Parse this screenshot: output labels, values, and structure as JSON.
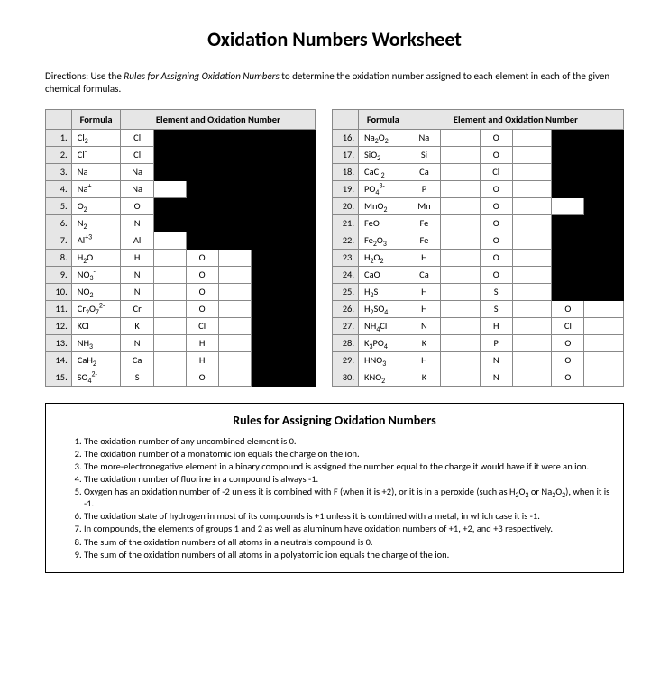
{
  "title": "Oxidation Numbers Worksheet",
  "directions_prefix": "Directions:  Use the ",
  "directions_italic": "Rules for Assigning Oxidation Numbers",
  "directions_suffix": " to determine the oxidation number assigned to each element in each of the given chemical formulas.",
  "left_header_formula": "Formula",
  "left_header_elox": "Element and Oxidation Number",
  "right_header_formula": "Formula",
  "right_header_elox": "Element and Oxidation Number",
  "left_rows": [
    {
      "n": "1.",
      "formula": "Cl<sub>2</sub>",
      "el1": "Cl",
      "el2": "",
      "el3": "",
      "black": [
        2,
        3,
        4,
        5,
        6
      ]
    },
    {
      "n": "2.",
      "formula": "Cl<sup>-</sup>",
      "el1": "Cl",
      "el2": "",
      "el3": "",
      "black": [
        2,
        3,
        4,
        5,
        6
      ]
    },
    {
      "n": "3.",
      "formula": "Na",
      "el1": "Na",
      "el2": "",
      "el3": "",
      "black": [
        2,
        3,
        4,
        5,
        6
      ]
    },
    {
      "n": "4.",
      "formula": "Na<sup>+</sup>",
      "el1": "Na",
      "el2": "",
      "el3": "",
      "black": [
        3,
        4,
        5,
        6
      ]
    },
    {
      "n": "5.",
      "formula": "O<sub>2</sub>",
      "el1": "O",
      "el2": "",
      "el3": "",
      "black": [
        2,
        3,
        4,
        5,
        6
      ]
    },
    {
      "n": "6.",
      "formula": "N<sub>2</sub>",
      "el1": "N",
      "el2": "",
      "el3": "",
      "black": [
        2,
        3,
        4,
        5,
        6
      ]
    },
    {
      "n": "7.",
      "formula": "Al<sup>+3</sup>",
      "el1": "Al",
      "el2": "",
      "el3": "",
      "black": [
        3,
        4,
        5,
        6
      ]
    },
    {
      "n": "8.",
      "formula": "H<sub>2</sub>O",
      "el1": "H",
      "el2": "O",
      "el3": "",
      "black": [
        5,
        6
      ]
    },
    {
      "n": "9.",
      "formula": "NO<sub>3</sub><sup>-</sup>",
      "el1": "N",
      "el2": "O",
      "el3": "",
      "black": [
        5,
        6
      ]
    },
    {
      "n": "10.",
      "formula": "NO<sub>2</sub>",
      "el1": "N",
      "el2": "O",
      "el3": "",
      "black": [
        5,
        6
      ]
    },
    {
      "n": "11.",
      "formula": "Cr<sub>2</sub>O<sub>7</sub><sup>2-</sup>",
      "el1": "Cr",
      "el2": "O",
      "el3": "",
      "black": [
        5,
        6
      ]
    },
    {
      "n": "12.",
      "formula": "KCl",
      "el1": "K",
      "el2": "Cl",
      "el3": "",
      "black": [
        5,
        6
      ]
    },
    {
      "n": "13.",
      "formula": "NH<sub>3</sub>",
      "el1": "N",
      "el2": "H",
      "el3": "",
      "black": [
        5,
        6
      ]
    },
    {
      "n": "14.",
      "formula": "CaH<sub>2</sub>",
      "el1": "Ca",
      "el2": "H",
      "el3": "",
      "black": [
        5,
        6
      ]
    },
    {
      "n": "15.",
      "formula": "SO<sub>4</sub><sup>2-</sup>",
      "el1": "S",
      "el2": "O",
      "el3": "",
      "black": [
        5,
        6
      ]
    }
  ],
  "right_rows": [
    {
      "n": "16.",
      "formula": "Na<sub>2</sub>O<sub>2</sub>",
      "el1": "Na",
      "el2": "O",
      "el3": "",
      "black": [
        5,
        6
      ]
    },
    {
      "n": "17.",
      "formula": "SiO<sub>2</sub>",
      "el1": "Si",
      "el2": "O",
      "el3": "",
      "black": [
        5,
        6
      ]
    },
    {
      "n": "18.",
      "formula": "CaCl<sub>2</sub>",
      "el1": "Ca",
      "el2": "Cl",
      "el3": "",
      "black": [
        5,
        6
      ]
    },
    {
      "n": "19.",
      "formula": "PO<sub>4</sub><sup>3-</sup>",
      "el1": "P",
      "el2": "O",
      "el3": "",
      "black": [
        5,
        6
      ]
    },
    {
      "n": "20.",
      "formula": "MnO<sub>2</sub>",
      "el1": "Mn",
      "el2": "O",
      "el3": "",
      "black": [
        6
      ]
    },
    {
      "n": "21.",
      "formula": "FeO",
      "el1": "Fe",
      "el2": "O",
      "el3": "",
      "black": [
        5,
        6
      ]
    },
    {
      "n": "22.",
      "formula": "Fe<sub>2</sub>O<sub>3</sub>",
      "el1": "Fe",
      "el2": "O",
      "el3": "",
      "black": [
        5,
        6
      ]
    },
    {
      "n": "23.",
      "formula": "H<sub>2</sub>O<sub>2</sub>",
      "el1": "H",
      "el2": "O",
      "el3": "",
      "black": [
        5,
        6
      ]
    },
    {
      "n": "24.",
      "formula": "CaO",
      "el1": "Ca",
      "el2": "O",
      "el3": "",
      "black": [
        5,
        6
      ]
    },
    {
      "n": "25.",
      "formula": "H<sub>2</sub>S",
      "el1": "H",
      "el2": "S",
      "el3": "",
      "black": [
        5,
        6
      ]
    },
    {
      "n": "26.",
      "formula": "H<sub>2</sub>SO<sub>4</sub>",
      "el1": "H",
      "el2": "S",
      "el3": "O",
      "black": []
    },
    {
      "n": "27.",
      "formula": "NH<sub>4</sub>Cl",
      "el1": "N",
      "el2": "H",
      "el3": "Cl",
      "black": []
    },
    {
      "n": "28.",
      "formula": "K<sub>3</sub>PO<sub>4</sub>",
      "el1": "K",
      "el2": "P",
      "el3": "O",
      "black": []
    },
    {
      "n": "29.",
      "formula": "HNO<sub>3</sub>",
      "el1": "H",
      "el2": "N",
      "el3": "O",
      "black": []
    },
    {
      "n": "30.",
      "formula": "KNO<sub>2</sub>",
      "el1": "K",
      "el2": "N",
      "el3": "O",
      "black": []
    }
  ],
  "rules_title": "Rules for Assigning Oxidation Numbers",
  "rules": [
    "The oxidation number of any uncombined element is 0.",
    "The oxidation number of a monatomic ion equals the charge on the ion.",
    "The more-electronegative element in a binary compound is assigned the number equal to the charge it would have if it were an ion.",
    "The oxidation number of fluorine in a compound is always -1.",
    "Oxygen has an oxidation number of -2 unless it is combined with F (when it is +2), or it is in a peroxide (such as H<sub>2</sub>O<sub>2</sub> or Na<sub>2</sub>O<sub>2</sub>), when it is -1.",
    "The oxidation state of hydrogen in most of its compounds is +1 unless it is combined with a metal, in which case it is -1.",
    "In compounds, the elements of groups 1 and 2 as well as aluminum have oxidation numbers of +1, +2, and +3 respectively.",
    "The sum of the oxidation numbers of all atoms in a neutrals compound is 0.",
    "The sum of the oxidation numbers of all atoms in a polyatomic ion equals the charge of the ion."
  ]
}
